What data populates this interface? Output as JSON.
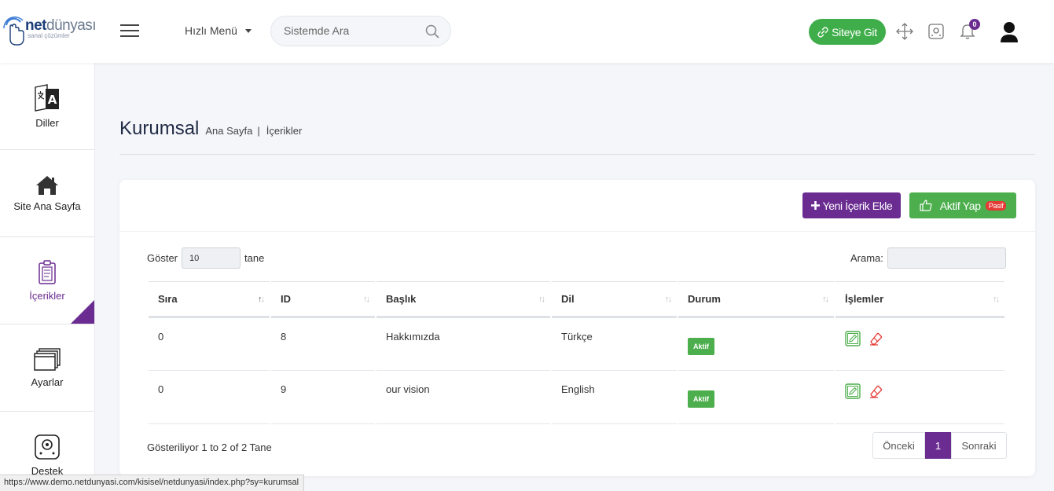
{
  "logo": {
    "net": "net",
    "dunyasi": "dünyası",
    "tagline": "sanal çözümler"
  },
  "header": {
    "quick_menu": "Hızlı Menü",
    "search_placeholder": "Sistemde Ara",
    "site_button": "Siteye Git",
    "notification_count": "0"
  },
  "sidebar": {
    "items": [
      {
        "label": "Diller",
        "icon": "language-icon"
      },
      {
        "label": "Site Ana Sayfa",
        "icon": "home-icon"
      },
      {
        "label": "İçerikler",
        "icon": "clipboard-icon",
        "active": true
      },
      {
        "label": "Ayarlar",
        "icon": "windows-icon"
      },
      {
        "label": "Destek",
        "icon": "support-icon"
      }
    ]
  },
  "page": {
    "title": "Kurumsal",
    "breadcrumb": [
      "Ana Sayfa",
      "İçerikler"
    ],
    "breadcrumb_sep": "|"
  },
  "toolbar": {
    "new_label": "Yeni İçerik Ekle",
    "activate_label": "Aktif Yap",
    "activate_badge": "Pasif"
  },
  "table_controls": {
    "show_label": "Göster",
    "show_value": "10",
    "show_suffix": "tane",
    "search_label": "Arama:"
  },
  "table": {
    "columns": [
      "Sıra",
      "ID",
      "Başlık",
      "Dil",
      "Durum",
      "İşlemler"
    ],
    "rows": [
      {
        "sira": "0",
        "id": "8",
        "baslik": "Hakkımızda",
        "dil": "Türkçe",
        "durum": "Aktif"
      },
      {
        "sira": "0",
        "id": "9",
        "baslik": "our vision",
        "dil": "English",
        "durum": "Aktif"
      }
    ]
  },
  "footer": {
    "info": "Gösteriliyor 1 to 2 of 2 Tane",
    "prev": "Önceki",
    "page": "1",
    "next": "Sonraki"
  },
  "status_bar": {
    "url": "https://www.demo.netdunyasi.com/kisisel/netdunyasi/index.php?sy=kurumsal"
  },
  "colors": {
    "accent": "#6a2c91",
    "success": "#4cae4c",
    "danger": "#e53935"
  }
}
